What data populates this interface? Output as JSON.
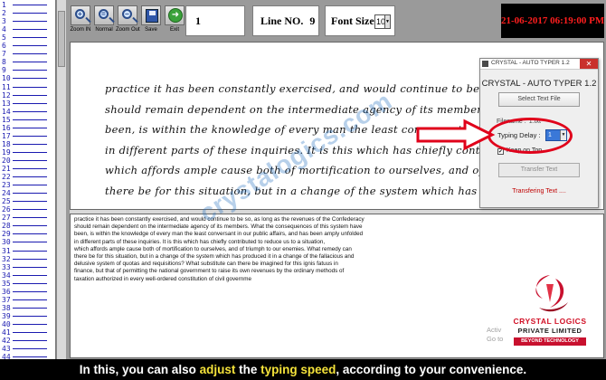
{
  "line_numbers": [
    "1",
    "2",
    "3",
    "4",
    "5",
    "6",
    "7",
    "8",
    "9",
    "10",
    "11",
    "12",
    "13",
    "14",
    "15",
    "16",
    "17",
    "18",
    "19",
    "20",
    "21",
    "22",
    "23",
    "24",
    "25",
    "26",
    "27",
    "28",
    "29",
    "30",
    "31",
    "32",
    "33",
    "34",
    "35",
    "36",
    "37",
    "38",
    "39",
    "40",
    "41",
    "42",
    "43",
    "44",
    "45"
  ],
  "toolbar": {
    "buttons": [
      {
        "name": "zoom-in",
        "label": "Zoom IN",
        "symbol": "+"
      },
      {
        "name": "normal",
        "label": "Normal",
        "symbol": "="
      },
      {
        "name": "zoom-out",
        "label": "Zoom Out",
        "symbol": "−"
      },
      {
        "name": "save",
        "label": "Save"
      },
      {
        "name": "exit",
        "label": "Exit"
      }
    ],
    "page_value": "1",
    "line_label": "Line NO.",
    "line_value": "9",
    "font_size_label": "Font Size",
    "font_size_value": "10",
    "clock": "21-06-2017 06:19:00 PM"
  },
  "handwriting_lines": [
    "practice it has been constantly exercised, and would continue to be so, as",
    "should remain dependent on the intermediate agency of its members. What th",
    "been, is within the knowledge of every man the least conversant in our publi",
    "in different parts of these inquiries. It is this which has chiefly contributed to",
    "which affords ample cause both of mortification to ourselves, and of triumph",
    "there be for this situation, but in a change of the system which has produced"
  ],
  "text_lines": [
    "practice it has been constantly exercised, and would continue to be so, as long as the revenues of the Confederacy",
    "should remain dependent on the intermediate agency of its members. What the consequences of this system have",
    "been, is within the knowledge of every man the least conversant in our public affairs, and has been amply unfolded",
    "in different parts of these inquiries. It is this which has chiefly contributed to reduce us to a situation,",
    "which affords ample cause both of mortification to ourselves, and of triumph to our enemies. What remedy can",
    "there be for this situation, but in a change of the system which has produced it in a change of the fallacious and",
    "delusive system of quotas and requisitions? What substitute can there be imagined for this ignis fatuus in",
    "finance, but that of permitting the national government to raise its own revenues by the ordinary methods of",
    "taxation authorized in every well-ordered constitution of civil governme"
  ],
  "watermark": "crystalogics.com",
  "dialog": {
    "window_title": "CRYSTAL - AUTO TYPER 1.2",
    "close_glyph": "✕",
    "heading": "CRYSTAL - AUTO TYPER 1.2",
    "select_button": "Select Text File",
    "filename_label": "Filename :",
    "filename_value": "1.txt",
    "delay_label": "Typing Delay :",
    "delay_value": "1",
    "keep_on_top_label": "Keep on Top",
    "keep_on_top_checked": "✔",
    "transfer_button": "Transfer Text",
    "status": "Transfering Text ...."
  },
  "logo": {
    "name_line1": "CRYSTAL LOGICS",
    "name_line2": "PRIVATE LIMITED",
    "tagline": "BEYOND TECHNOLOGY",
    "color": "#d10f25"
  },
  "activate_windows": {
    "line1": "Activ",
    "line2": "Go to"
  },
  "caption": {
    "part1": "In this, you can also ",
    "hl1": "adjust",
    "part2": " the ",
    "hl2": "typing speed",
    "part3": ", according to your convenience."
  },
  "colors": {
    "annotation_red": "#e0001a",
    "clock_red": "#ff1e1e",
    "caption_highlight": "#f4e23a"
  }
}
